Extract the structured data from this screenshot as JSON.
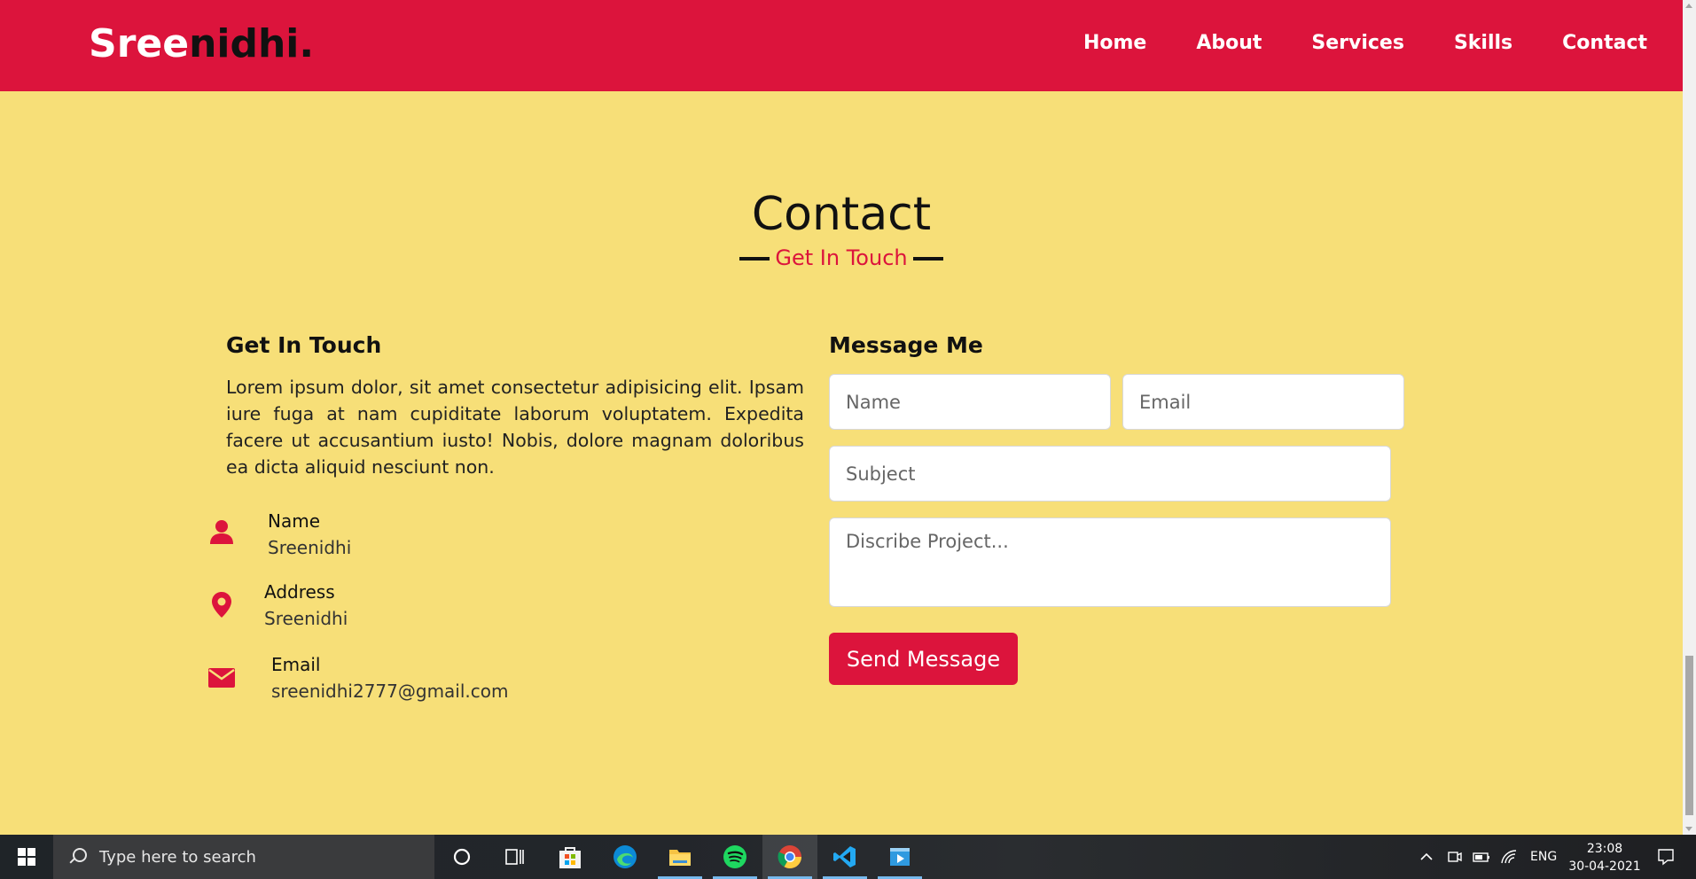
{
  "navbar": {
    "logo_part1": "Sree",
    "logo_part2": "nidhi.",
    "links": [
      "Home",
      "About",
      "Services",
      "Skills",
      "Contact"
    ]
  },
  "section": {
    "title": "Contact",
    "subtitle": "Get In Touch"
  },
  "left": {
    "heading": "Get In Touch",
    "paragraph": "Lorem ipsum dolor, sit amet consectetur adipisicing elit. Ipsam iure fuga at nam cupiditate laborum voluptatem. Expedita facere ut accusantium iusto! Nobis, dolore magnam doloribus ea dicta aliquid nesciunt non.",
    "info": [
      {
        "icon": "user-icon",
        "head": "Name",
        "value": "Sreenidhi"
      },
      {
        "icon": "map-marker-icon",
        "head": "Address",
        "value": "Sreenidhi"
      },
      {
        "icon": "envelope-icon",
        "head": "Email",
        "value": "sreenidhi2777@gmail.com"
      }
    ]
  },
  "form": {
    "heading": "Message Me",
    "name_placeholder": "Name",
    "email_placeholder": "Email",
    "subject_placeholder": "Subject",
    "project_placeholder": "Discribe Project...",
    "send_label": "Send Message"
  },
  "taskbar": {
    "search_text": "Type here to search",
    "lang": "ENG",
    "time": "23:08",
    "date": "30-04-2021",
    "apps": [
      "cortana-icon",
      "task-view-icon",
      "store-icon",
      "edge-icon",
      "file-explorer-icon",
      "spotify-icon",
      "chrome-icon",
      "vscode-icon",
      "media-player-icon"
    ]
  },
  "colors": {
    "accent": "#dc143c",
    "background": "#f7df78"
  }
}
